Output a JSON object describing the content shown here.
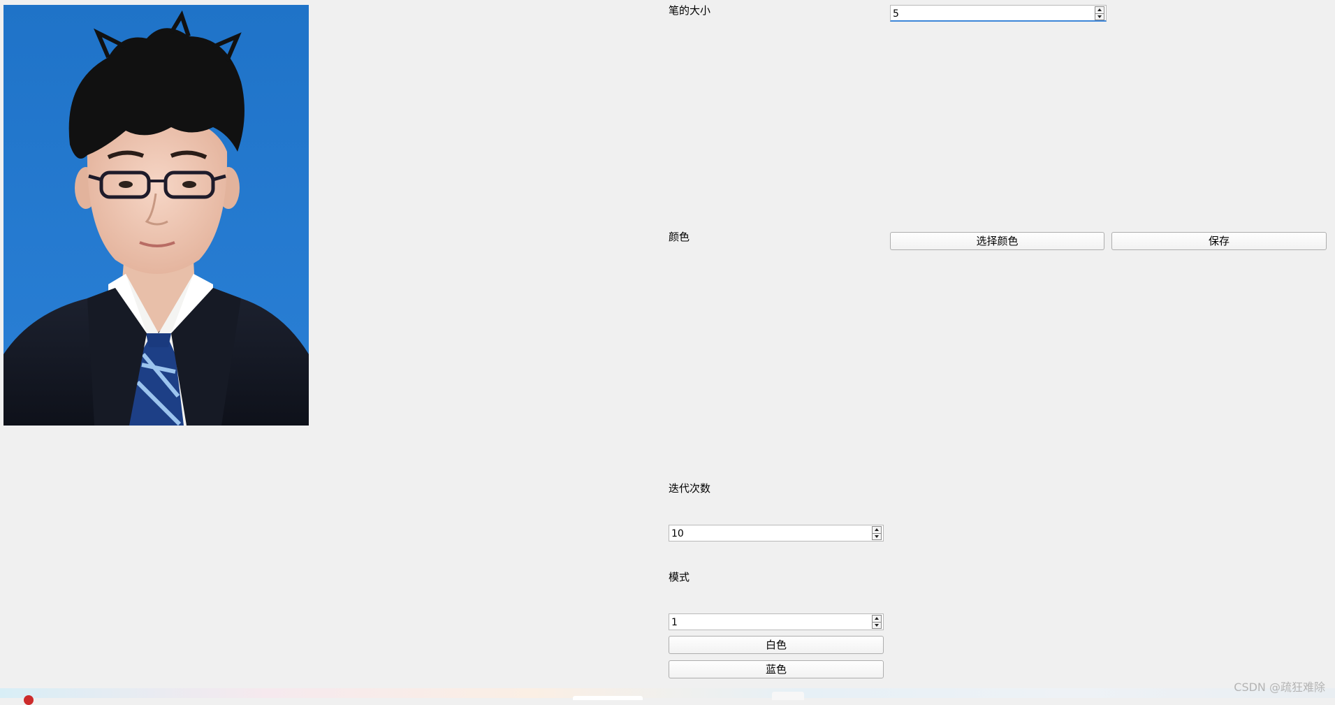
{
  "brush_size": {
    "label": "笔的大小",
    "value": "5"
  },
  "color": {
    "label": "颜色",
    "choose_button": "选择颜色",
    "save_button": "保存"
  },
  "iterations": {
    "label": "迭代次数",
    "value": "10"
  },
  "mode": {
    "label": "模式",
    "value": "1"
  },
  "background_buttons": {
    "white": "白色",
    "blue": "蓝色"
  },
  "watermark": "CSDN @疏狂难除",
  "colors": {
    "photo_background": "#2277cc",
    "window_background": "#f0f0f0",
    "focus_underline": "#3d86d8"
  }
}
